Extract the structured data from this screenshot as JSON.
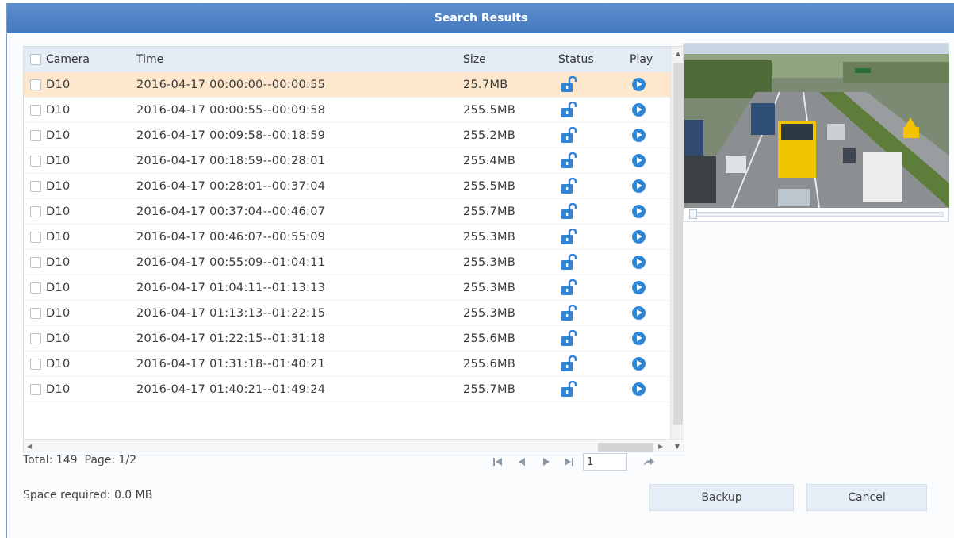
{
  "window": {
    "title": "Search Results"
  },
  "table": {
    "columns": {
      "camera": "Camera",
      "time": "Time",
      "size": "Size",
      "status": "Status",
      "play": "Play"
    },
    "rows": [
      {
        "camera": "D10",
        "time": "2016-04-17 00:00:00--00:00:55",
        "size": "25.7MB",
        "status_icon": "unlock-icon",
        "selected": true
      },
      {
        "camera": "D10",
        "time": "2016-04-17 00:00:55--00:09:58",
        "size": "255.5MB",
        "status_icon": "unlock-icon"
      },
      {
        "camera": "D10",
        "time": "2016-04-17 00:09:58--00:18:59",
        "size": "255.2MB",
        "status_icon": "unlock-icon"
      },
      {
        "camera": "D10",
        "time": "2016-04-17 00:18:59--00:28:01",
        "size": "255.4MB",
        "status_icon": "unlock-icon"
      },
      {
        "camera": "D10",
        "time": "2016-04-17 00:28:01--00:37:04",
        "size": "255.5MB",
        "status_icon": "unlock-icon"
      },
      {
        "camera": "D10",
        "time": "2016-04-17 00:37:04--00:46:07",
        "size": "255.7MB",
        "status_icon": "unlock-icon"
      },
      {
        "camera": "D10",
        "time": "2016-04-17 00:46:07--00:55:09",
        "size": "255.3MB",
        "status_icon": "unlock-icon"
      },
      {
        "camera": "D10",
        "time": "2016-04-17 00:55:09--01:04:11",
        "size": "255.3MB",
        "status_icon": "unlock-icon"
      },
      {
        "camera": "D10",
        "time": "2016-04-17 01:04:11--01:13:13",
        "size": "255.3MB",
        "status_icon": "unlock-icon"
      },
      {
        "camera": "D10",
        "time": "2016-04-17 01:13:13--01:22:15",
        "size": "255.3MB",
        "status_icon": "unlock-icon"
      },
      {
        "camera": "D10",
        "time": "2016-04-17 01:22:15--01:31:18",
        "size": "255.6MB",
        "status_icon": "unlock-icon"
      },
      {
        "camera": "D10",
        "time": "2016-04-17 01:31:18--01:40:21",
        "size": "255.6MB",
        "status_icon": "unlock-icon"
      },
      {
        "camera": "D10",
        "time": "2016-04-17 01:40:21--01:49:24",
        "size": "255.7MB",
        "status_icon": "unlock-icon"
      }
    ]
  },
  "footer": {
    "total": "Total: 149",
    "page": "Page: 1/2",
    "page_input": "1",
    "space_required": "Space required: 0.0 MB"
  },
  "buttons": {
    "backup": "Backup",
    "cancel": "Cancel"
  },
  "colors": {
    "titlebar": "#4a7ec3",
    "selected_row": "#fde7cd",
    "accent": "#2f86d6",
    "header_bg": "#e4ecf6"
  }
}
